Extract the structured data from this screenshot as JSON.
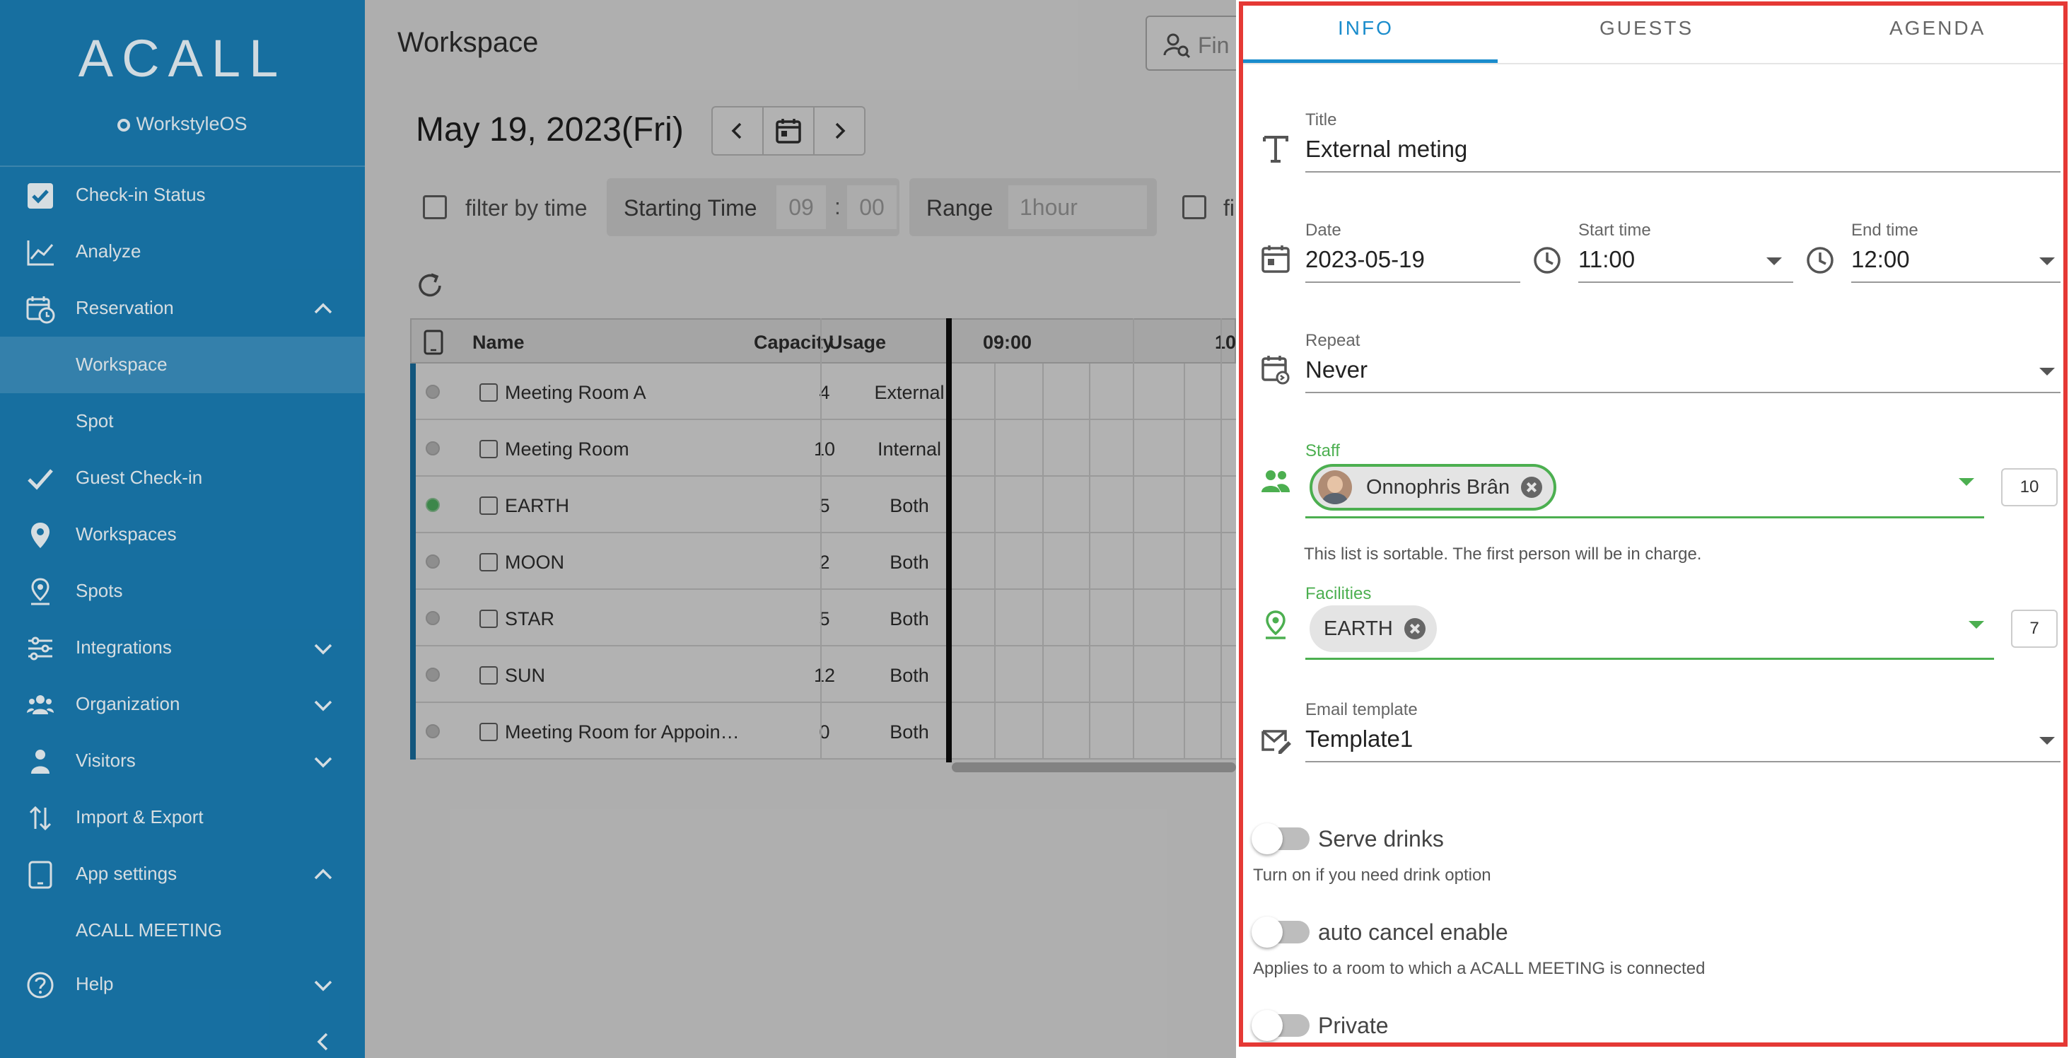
{
  "sidebar": {
    "logo": "ACALL",
    "product": "WorkstyleOS",
    "items": [
      {
        "label": "Check-in Status"
      },
      {
        "label": "Analyze"
      },
      {
        "label": "Reservation"
      },
      {
        "label": "Workspace"
      },
      {
        "label": "Spot"
      },
      {
        "label": "Guest Check-in"
      },
      {
        "label": "Workspaces"
      },
      {
        "label": "Spots"
      },
      {
        "label": "Integrations"
      },
      {
        "label": "Organization"
      },
      {
        "label": "Visitors"
      },
      {
        "label": "Import & Export"
      },
      {
        "label": "App settings"
      },
      {
        "label": "ACALL MEETING"
      },
      {
        "label": "Help"
      }
    ]
  },
  "main": {
    "title": "Workspace",
    "find_placeholder": "Fin",
    "date": "May 19, 2023(Fri)",
    "filter_by_time": "filter by time",
    "starting_time_label": "Starting Time",
    "start_hour": "09",
    "start_sep": ":",
    "start_min": "00",
    "range_label": "Range",
    "range_value": "1hour",
    "filter2_label": "fi",
    "table": {
      "headers": {
        "name": "Name",
        "capacity": "Capacity",
        "usage": "Usage",
        "t1": "09:00",
        "t2": "10"
      },
      "rows": [
        {
          "name": "Meeting Room A",
          "capacity": "4",
          "usage": "External"
        },
        {
          "name": "Meeting Room",
          "capacity": "10",
          "usage": "Internal"
        },
        {
          "name": "EARTH",
          "capacity": "5",
          "usage": "Both"
        },
        {
          "name": "MOON",
          "capacity": "2",
          "usage": "Both"
        },
        {
          "name": "STAR",
          "capacity": "5",
          "usage": "Both"
        },
        {
          "name": "SUN",
          "capacity": "12",
          "usage": "Both"
        },
        {
          "name": "Meeting Room for Appoin…",
          "capacity": "0",
          "usage": "Both"
        }
      ]
    }
  },
  "panel": {
    "tabs": {
      "info": "INFO",
      "guests": "GUESTS",
      "agenda": "AGENDA"
    },
    "title_label": "Title",
    "title_value": "External meting",
    "date_label": "Date",
    "date_value": "2023-05-19",
    "start_label": "Start time",
    "start_value": "11:00",
    "end_label": "End time",
    "end_value": "12:00",
    "repeat_label": "Repeat",
    "repeat_value": "Never",
    "staff_label": "Staff",
    "staff_chip": "Onnophris Brân",
    "staff_count": "10",
    "staff_hint": "This list is sortable. The first person will be in charge.",
    "facilities_label": "Facilities",
    "facility_chip": "EARTH",
    "facilities_count": "7",
    "email_label": "Email template",
    "email_value": "Template1",
    "serve_drinks": "Serve drinks",
    "serve_drinks_hint": "Turn on if you need drink option",
    "auto_cancel": "auto cancel enable",
    "auto_cancel_hint": "Applies to a room to which a ACALL MEETING is connected",
    "private": "Private"
  },
  "colors": {
    "sidebar": "#1a7cb3",
    "accent": "#1a8ccc",
    "green": "#4caf50",
    "frame": "#e53935"
  }
}
